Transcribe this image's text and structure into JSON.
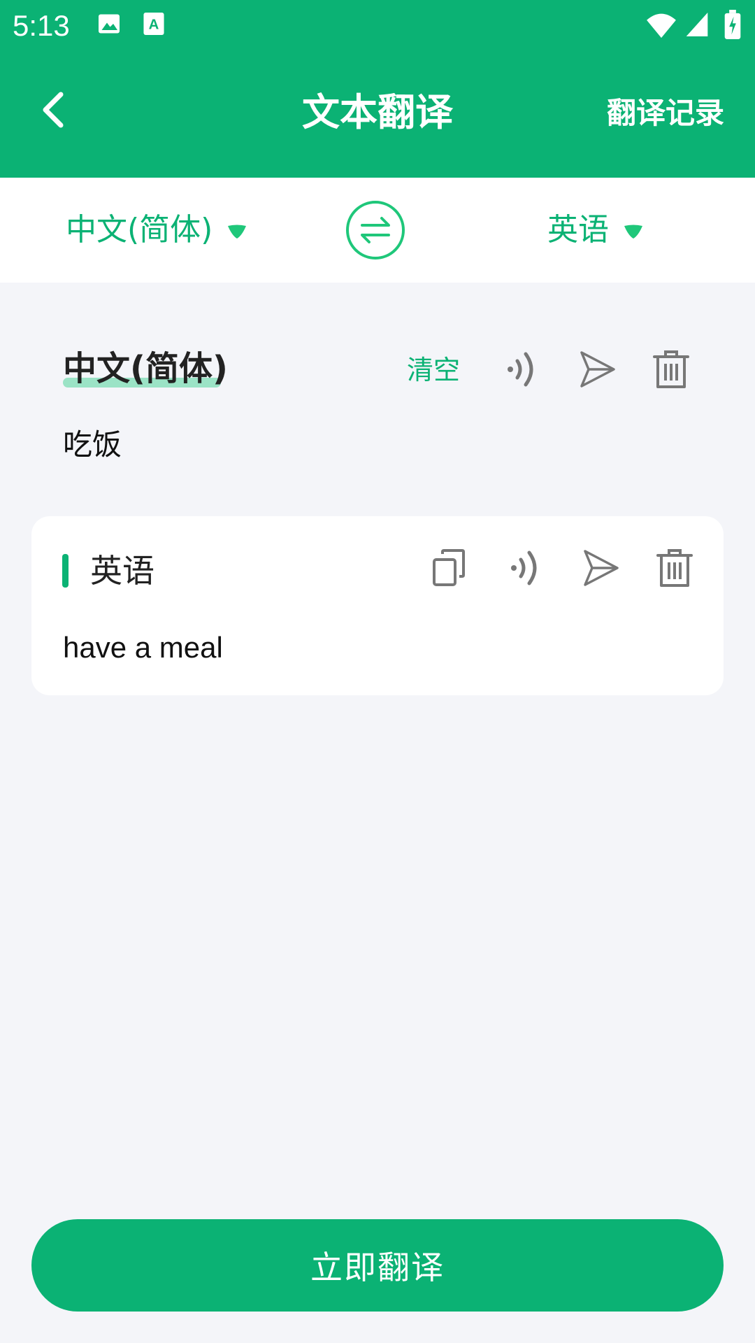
{
  "status_bar": {
    "time": "5:13",
    "icons": [
      "image-icon",
      "a11y-text-icon",
      "wifi-icon",
      "signal-icon",
      "battery-icon"
    ]
  },
  "app_bar": {
    "title": "文本翻译",
    "history_label": "翻译记录",
    "back_icon": "chevron-left-icon"
  },
  "language_selector": {
    "source": "中文(简体)",
    "target": "英语",
    "swap_icon": "swap-arrows-icon"
  },
  "source_panel": {
    "language": "中文(简体)",
    "clear_label": "清空",
    "text": "吃饭",
    "actions": [
      "speaker-icon",
      "send-icon",
      "trash-icon"
    ]
  },
  "result_panel": {
    "language": "英语",
    "text": "have a meal",
    "actions": [
      "copy-icon",
      "speaker-icon",
      "send-icon",
      "trash-icon"
    ]
  },
  "translate_button": {
    "label": "立即翻译"
  },
  "colors": {
    "primary": "#0bb274",
    "background": "#f4f5f9",
    "icon_gray": "#888888",
    "highlight": "#9be3c6"
  }
}
